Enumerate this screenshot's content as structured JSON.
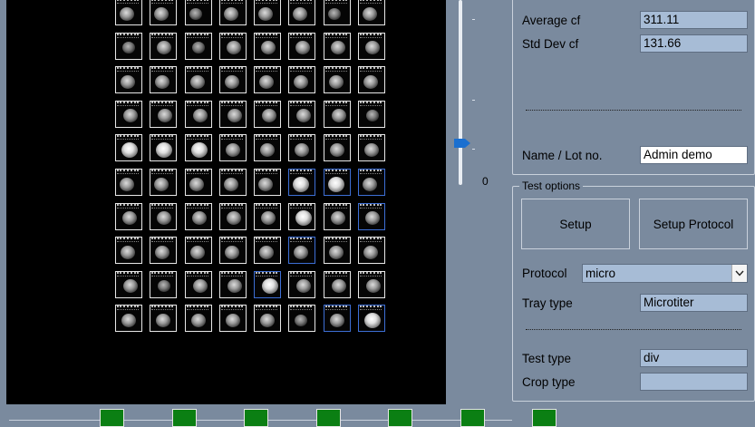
{
  "stats": {
    "average_cf_label": "Average cf",
    "average_cf_value": "311.11",
    "std_dev_label": "Std Dev cf",
    "std_dev_value": "131.66",
    "name_lot_label": "Name / Lot no.",
    "name_lot_value": "Admin demo"
  },
  "slider": {
    "min_label": "0",
    "level": 0.2
  },
  "test_options": {
    "legend": "Test options",
    "setup_button": "Setup",
    "setup_protocol_button": "Setup Protocol",
    "protocol_label": "Protocol",
    "protocol_value": "micro",
    "tray_type_label": "Tray type",
    "tray_type_value": "Microtiter",
    "test_type_label": "Test type",
    "test_type_value": "div",
    "crop_type_label": "Crop type",
    "crop_type_value": ""
  },
  "colors": {
    "panel": "#7a8a9e",
    "field": "#a7bcd6",
    "indicator_green": "#0b7f13",
    "slider_thumb": "#1a6fd0"
  },
  "indicators": {
    "count": 7
  }
}
